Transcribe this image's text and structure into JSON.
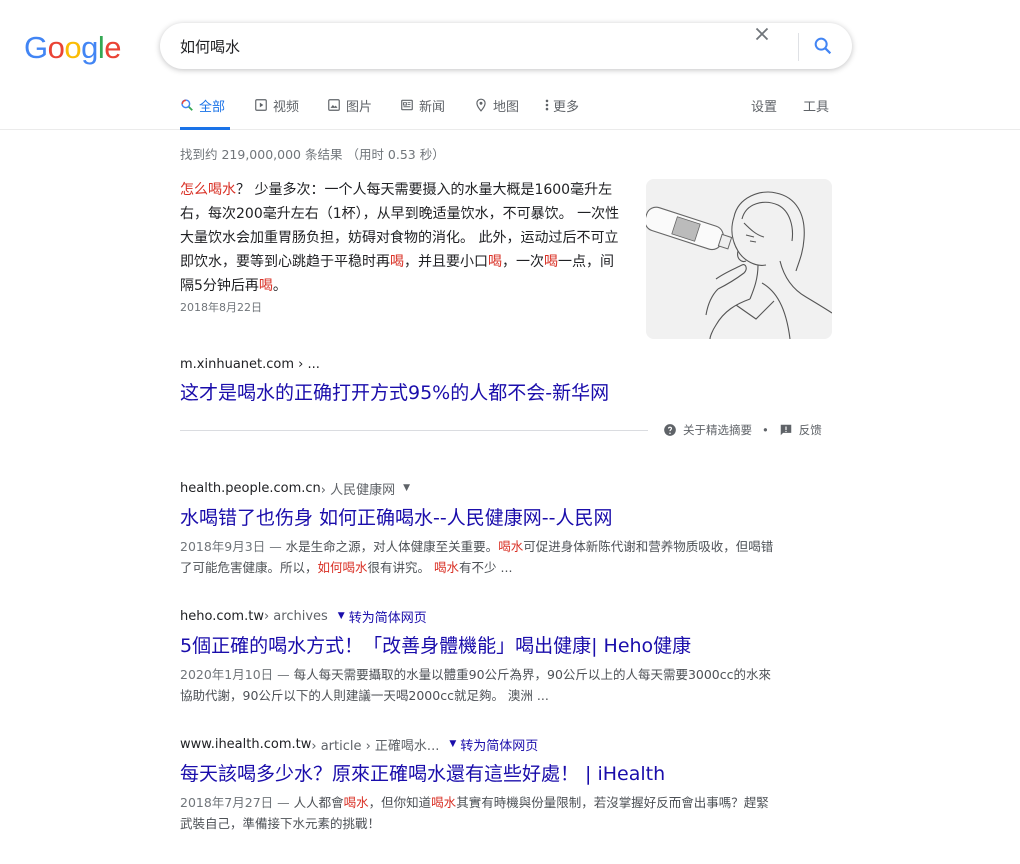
{
  "logo": {
    "letters": [
      "G",
      "o",
      "o",
      "g",
      "l",
      "e"
    ],
    "colors": [
      "#4285F4",
      "#EA4335",
      "#FBBC05",
      "#4285F4",
      "#34A853",
      "#EA4335"
    ]
  },
  "search": {
    "query": "如何喝水",
    "clear_icon": "close-icon",
    "search_icon": "search-icon"
  },
  "tabs": [
    {
      "label": "全部",
      "icon": "search-icon",
      "active": true
    },
    {
      "label": "视频",
      "icon": "video-icon"
    },
    {
      "label": "图片",
      "icon": "image-icon"
    },
    {
      "label": "新闻",
      "icon": "news-icon"
    },
    {
      "label": "地图",
      "icon": "map-pin-icon"
    },
    {
      "label": "更多",
      "icon": "more-vert-icon"
    }
  ],
  "tools": {
    "settings": "设置",
    "tools": "工具"
  },
  "stats": "找到约 219,000,000 条结果 （用时 0.53 秒）",
  "featured": {
    "q_hl": "怎么喝水",
    "p1": "？ 少量多次：一个人每天需要摄入的水量大概是1600毫升左右，每次200毫升左右（1杯），从早到晚适量饮水，不可暴饮。 一次性大量饮水会加重胃肠负担，妨碍对食物的消化。 此外，运动过后不可立即饮水，要等到心跳趋于平稳时再",
    "hl1": "喝",
    "p2": "，并且要小口",
    "hl2": "喝",
    "p3": "，一次",
    "hl3": "喝",
    "p4": "一点，间隔5分钟后再",
    "hl4": "喝",
    "p5": "。",
    "date": "2018年8月22日",
    "url": "m.xinhuanet.com › ...",
    "title": "这才是喝水的正确打开方式95%的人都不会-新华网",
    "about": "关于精选摘要",
    "dot": "•",
    "feedback": "反馈"
  },
  "results": [
    {
      "domain": "health.people.com.cn",
      "crumb": " › 人民健康网",
      "title": "水喝错了也伤身 如何正确喝水--人民健康网--人民网",
      "date": "2018年9月3日 — ",
      "d1": "水是生命之源，对人体健康至关重要。",
      "h1": "喝水",
      "d2": "可促进身体新陈代谢和营养物质吸收，但喝错了可能危害健康。所以，",
      "h2": "如何喝水",
      "d3": "很有讲究。 ",
      "h3": "喝水",
      "d4": "有不少 ..."
    },
    {
      "domain": "heho.com.tw",
      "crumb": " › archives",
      "translate": "转为简体网页",
      "title": "5個正確的喝水方式！「改善身體機能」喝出健康| Heho健康",
      "date": "2020年1月10日 — ",
      "d1": "每人每天需要攝取的水量以體重90公斤為界，90公斤以上的人每天需要3000cc的水來協助代謝，90公斤以下的人則建議一天喝2000cc就足夠。 澳洲 ..."
    },
    {
      "domain": "www.ihealth.com.tw",
      "crumb": " › article › 正確喝水...",
      "translate": "转为简体网页",
      "title": "每天該喝多少水？原來正確喝水還有這些好處！ | iHealth",
      "date": "2018年7月27日 — ",
      "d1": "人人都會",
      "h1": "喝水",
      "d2": "，但你知道",
      "h2": "喝水",
      "d3": "其實有時機與份量限制，若沒掌握好反而會出事嗎？趕緊武裝自己，準備接下水元素的挑戰！"
    }
  ]
}
